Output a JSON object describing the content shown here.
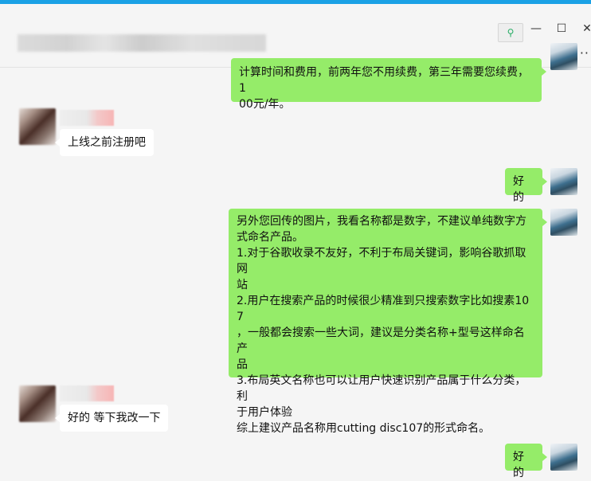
{
  "window": {
    "pin_icon": "pin-icon",
    "minimize_glyph": "—",
    "maximize_glyph": "☐",
    "close_glyph": "✕",
    "more_glyph": "··"
  },
  "messages": [
    {
      "side": "out",
      "lines": [
        "计算时间和费用，前两年您不用续费，第三年需要您续费，1",
        "00元/年。"
      ]
    },
    {
      "side": "in",
      "text": "上线之前注册吧"
    },
    {
      "side": "out",
      "text": "好的"
    },
    {
      "side": "out",
      "lines": [
        "另外您回传的图片，我看名称都是数字，不建议单纯数字方",
        "式命名产品。",
        "1.对于谷歌收录不友好，不利于布局关键词，影响谷歌抓取网",
        "站",
        "2.用户在搜索产品的时候很少精准到只搜索数字比如搜素107",
        "，一般都会搜索一些大词，建议是分类名称+型号这样命名产",
        "品",
        "3.布局英文名称也可以让用户快速识别产品属于什么分类，利",
        "于用户体验",
        "综上建议产品名称用cutting disc107的形式命名。"
      ]
    },
    {
      "side": "in",
      "text": "好的 等下我改一下"
    },
    {
      "side": "out",
      "text": "好的"
    }
  ],
  "colors": {
    "accent_bar": "#1aa1e5",
    "bubble_out": "#95ec69",
    "bubble_in": "#ffffff",
    "background": "#f5f5f5"
  }
}
